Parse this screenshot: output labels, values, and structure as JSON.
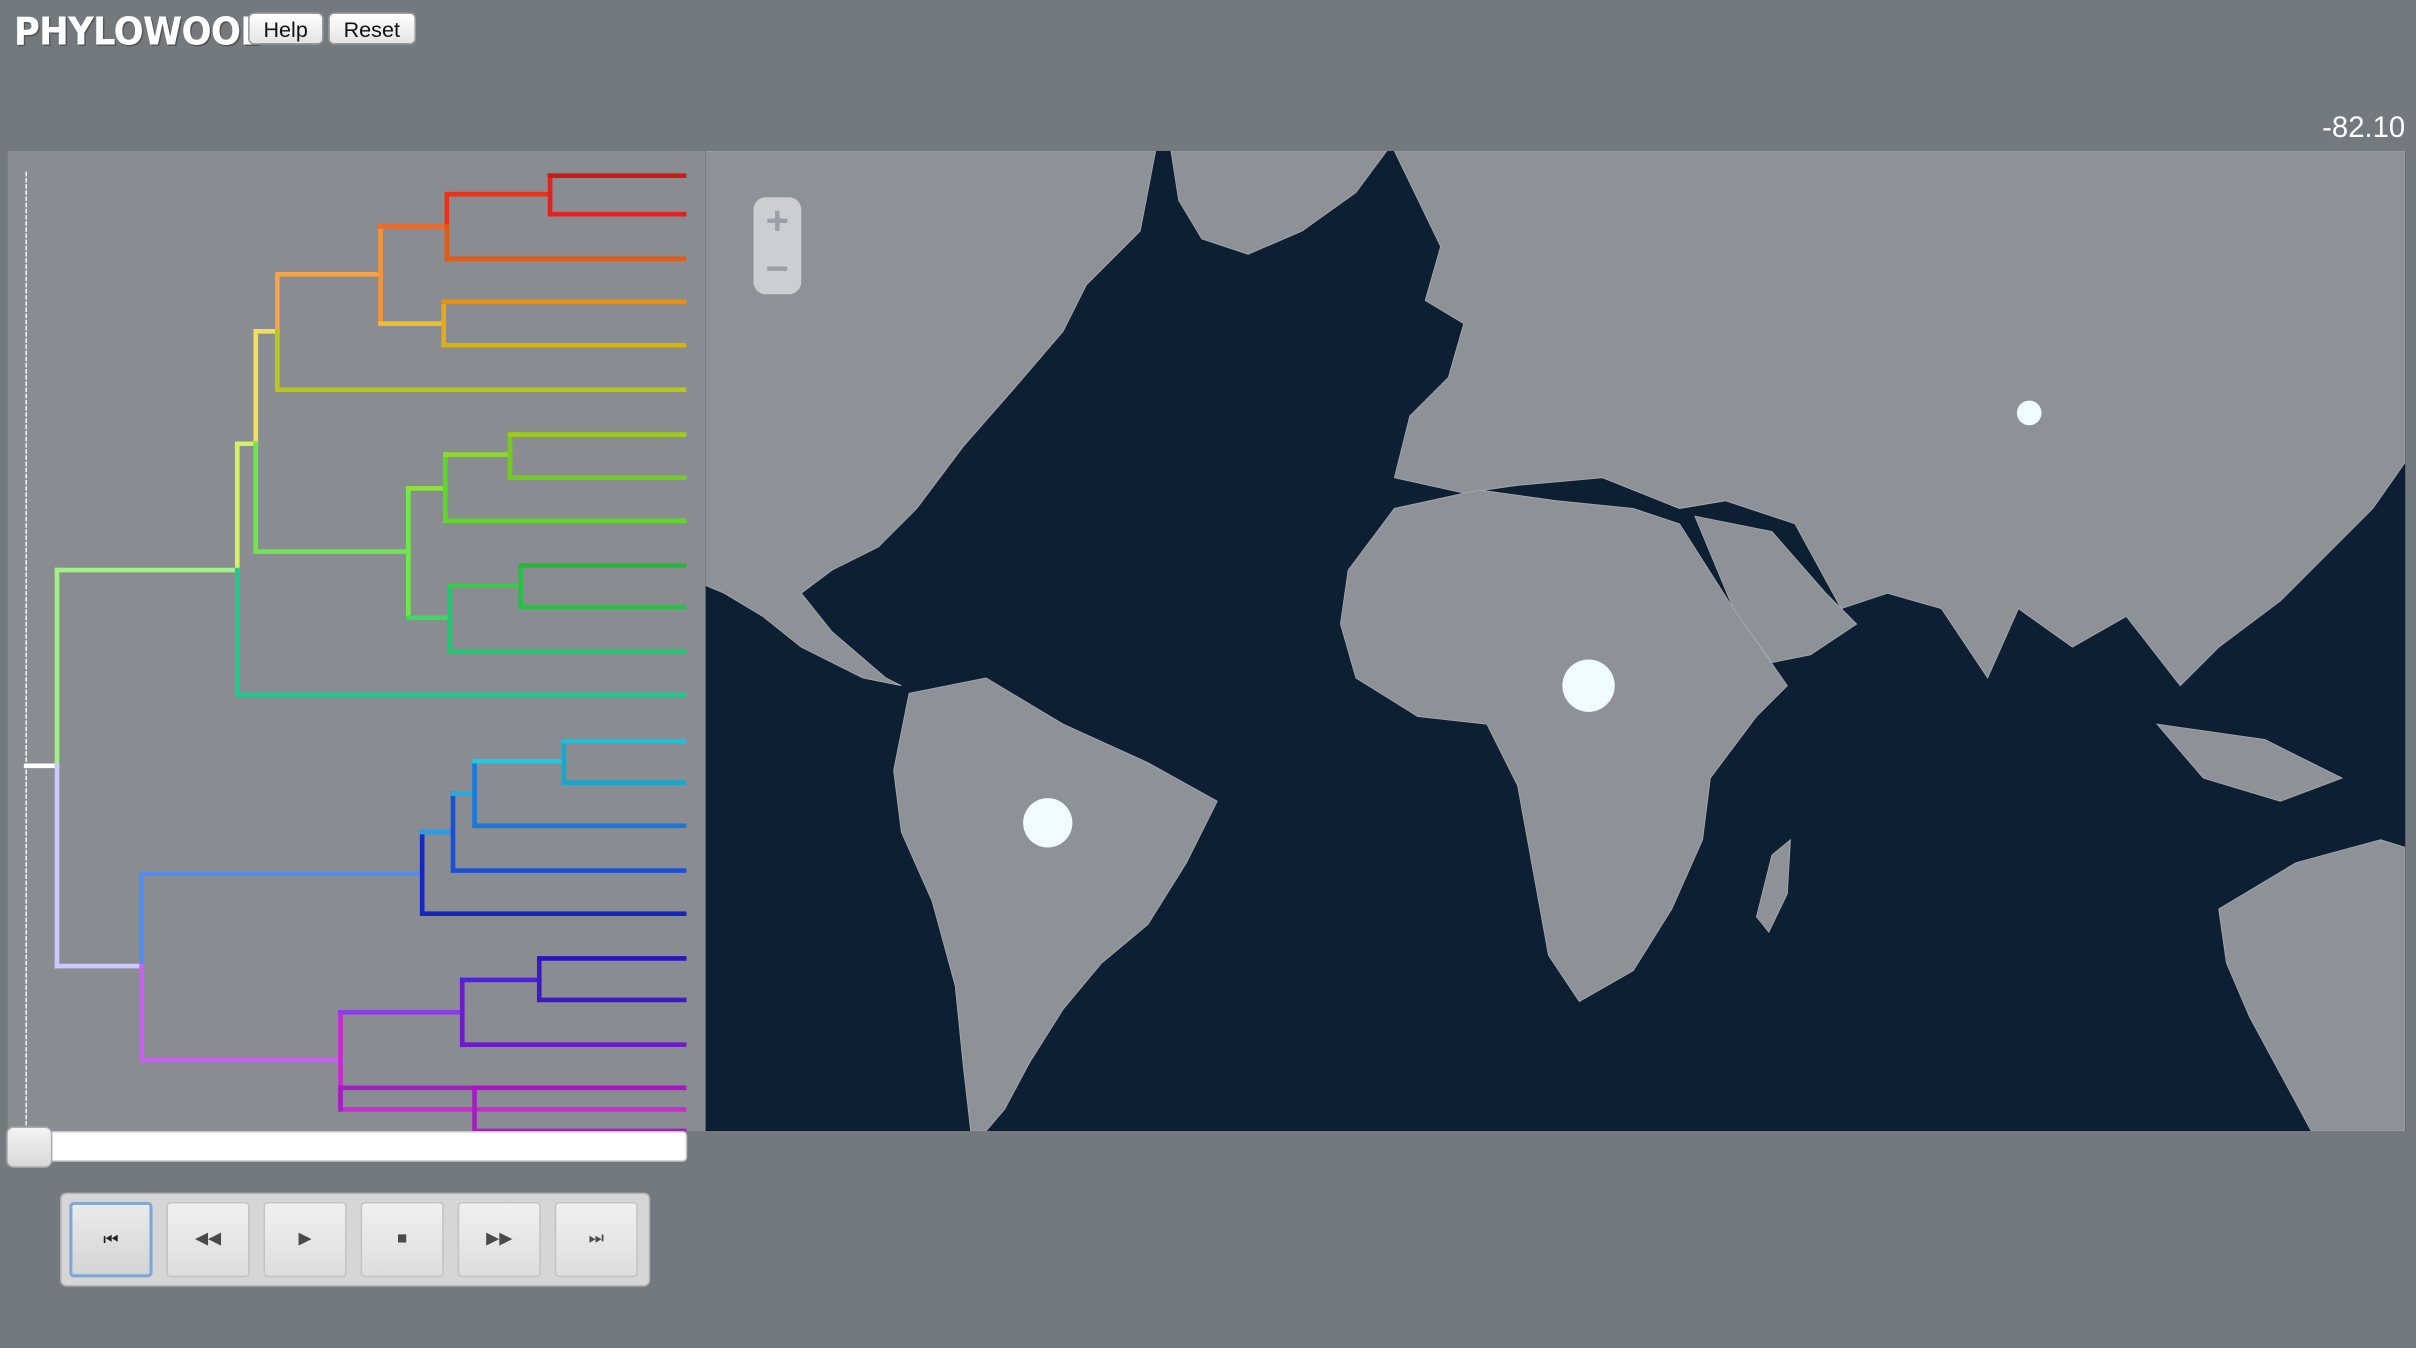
{
  "app": {
    "logo": "PHYLOWOOD",
    "help_label": "Help",
    "reset_label": "Reset"
  },
  "time_display": "-82.10",
  "map": {
    "zoom_in": "+",
    "zoom_out": "−",
    "ocean_color": "#0d1f33",
    "land_color": "#8e9296"
  },
  "playback": {
    "first_label": "⏮",
    "first_icon": "skip-to-start-icon",
    "rewind_label": "◀◀",
    "rewind_icon": "rewind-icon",
    "play_label": "▶",
    "play_icon": "play-icon",
    "stop_label": "■",
    "stop_icon": "stop-icon",
    "forward_label": "▶▶",
    "forward_icon": "fast-forward-icon",
    "last_label": "⏭",
    "last_icon": "skip-to-end-icon",
    "timeline_position": 0
  }
}
